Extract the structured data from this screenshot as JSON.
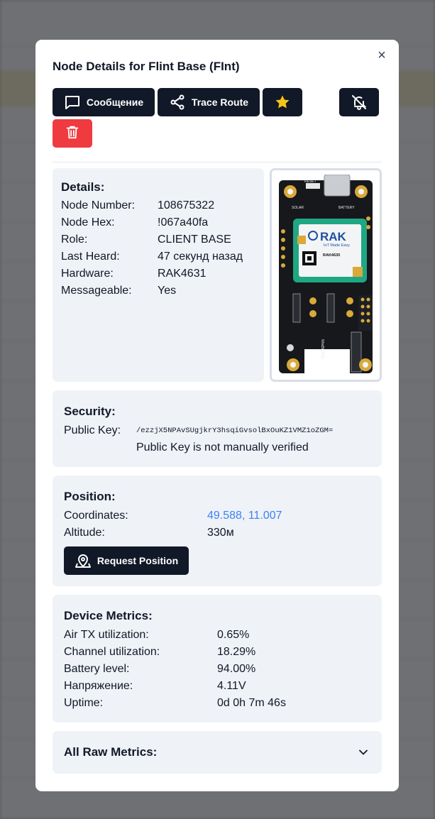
{
  "modal": {
    "title": "Node Details for Flint Base (FInt)",
    "close_glyph": "×"
  },
  "toolbar": {
    "message_label": "Сообщение",
    "trace_route_label": "Trace Route",
    "favorite_icon": "star-icon",
    "mute_icon": "bell-off-icon",
    "delete_icon": "trash-icon"
  },
  "details": {
    "heading": "Details:",
    "rows": [
      {
        "label": "Node Number:",
        "value": "108675322"
      },
      {
        "label": "Node Hex:",
        "value": "!067a40fa"
      },
      {
        "label": "Role:",
        "value": "CLIENT BASE"
      },
      {
        "label": "Last Heard:",
        "value": "47 секунд назад"
      },
      {
        "label": "Hardware:",
        "value": "RAK4631"
      },
      {
        "label": "Messageable:",
        "value": "Yes"
      }
    ]
  },
  "device_image": {
    "brand": "RAK",
    "tagline": "IoT Made Easy",
    "model": "RAK4630",
    "reset_label": "RESET",
    "solar_label": "SOLAR",
    "battery_label": "BATTERY",
    "block_label": "WisBLOCK"
  },
  "security": {
    "heading": "Security:",
    "public_key_label": "Public Key:",
    "public_key_value": "/ezzjX5NPAvSUgjkrY3hsqiGvsolBxOuKZ1VMZ1oZGM=",
    "verification_note": "Public Key is not manually verified"
  },
  "position": {
    "heading": "Position:",
    "coordinates_label": "Coordinates:",
    "coordinates_value": "49.588, 11.007",
    "altitude_label": "Altitude:",
    "altitude_value": "330м",
    "request_label": "Request Position"
  },
  "metrics": {
    "heading": "Device Metrics:",
    "rows": [
      {
        "label": "Air TX utilization:",
        "value": "0.65%"
      },
      {
        "label": "Channel utilization:",
        "value": "18.29%"
      },
      {
        "label": "Battery level:",
        "value": "94.00%"
      },
      {
        "label": "Напряжение:",
        "value": "4.11V"
      },
      {
        "label": "Uptime:",
        "value": "0d 0h 7m 46s"
      }
    ]
  },
  "raw_metrics": {
    "heading": "All Raw Metrics:"
  },
  "colors": {
    "primary_button": "#111827",
    "danger_button": "#ef3a3f",
    "star": "#f5c518",
    "link": "#3b82f6",
    "card_bg": "#eff2f7"
  }
}
